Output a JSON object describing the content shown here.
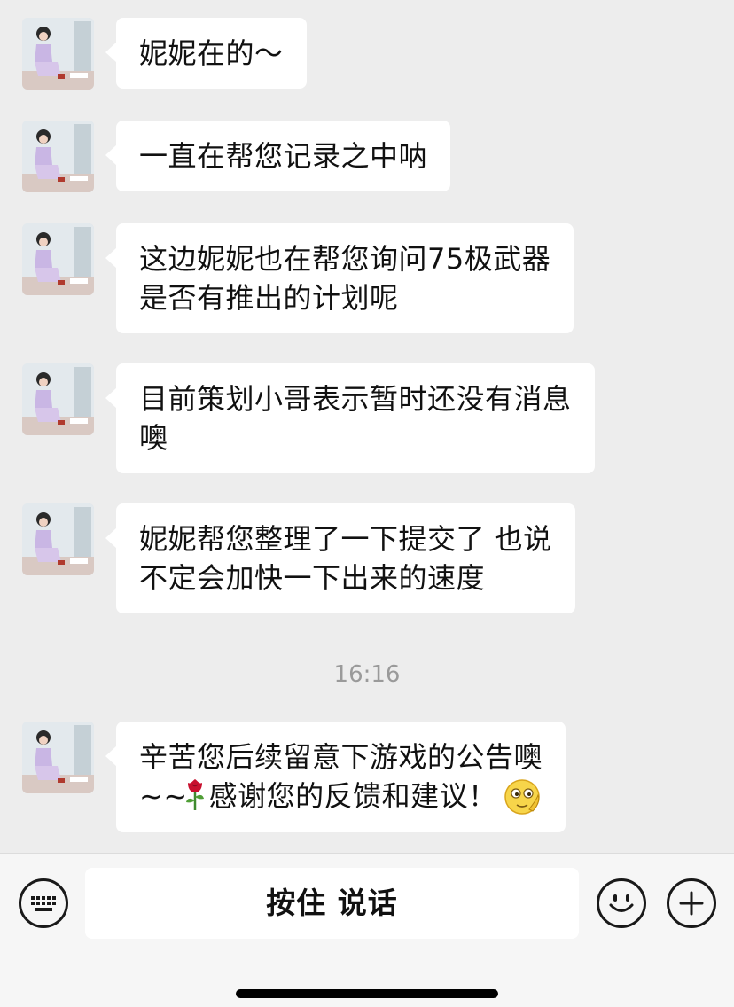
{
  "chat": {
    "messages": [
      {
        "lines": [
          "妮妮在的～"
        ]
      },
      {
        "lines": [
          "一直在帮您记录之中呐"
        ]
      },
      {
        "lines": [
          "这边妮妮也在帮您询问75极武器",
          "是否有推出的计划呢"
        ]
      },
      {
        "lines": [
          "目前策划小哥表示暂时还没有消息",
          "噢"
        ]
      },
      {
        "lines": [
          "妮妮帮您整理了一下提交了  也说",
          "不定会加快一下出来的速度"
        ]
      }
    ],
    "timestamp": "16:16",
    "last_message": {
      "line1": "辛苦您后续留意下游戏的公告噢",
      "line2_prefix": "~~",
      "line2_text": "感谢您的反馈和建议！",
      "emojis": [
        "rose-emoji",
        "thinking-smile-emoji"
      ]
    }
  },
  "input_bar": {
    "hold_to_talk_label": "按住 说话",
    "icons": [
      "keyboard-icon",
      "emoji-icon",
      "plus-icon"
    ]
  }
}
